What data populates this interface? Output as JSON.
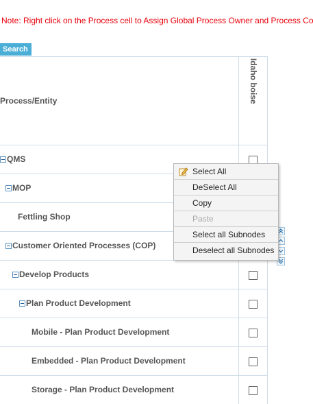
{
  "note": "Note: Right click on the Process cell to Assign Global Process Owner and Process Coor",
  "toolbar": {
    "search_label": "Search"
  },
  "grid": {
    "header_label": "Process/Entity",
    "column_label": "Idaho boise",
    "rows": [
      {
        "label": "QMS"
      },
      {
        "label": "MOP"
      },
      {
        "label": "Fettling Shop"
      },
      {
        "label": "Customer Oriented Processes (COP)"
      },
      {
        "label": "Develop Products"
      },
      {
        "label": "Plan Product Development"
      },
      {
        "label": "Mobile - Plan Product Development"
      },
      {
        "label": "Embedded - Plan Product Development"
      },
      {
        "label": "Storage - Plan Product Development"
      }
    ]
  },
  "context_menu": {
    "items": [
      {
        "label": "Select All"
      },
      {
        "label": "DeSelect All"
      },
      {
        "label": "Copy"
      },
      {
        "label": "Paste"
      },
      {
        "label": "Select all Subnodes"
      },
      {
        "label": "Deselect all Subnodes"
      }
    ]
  }
}
